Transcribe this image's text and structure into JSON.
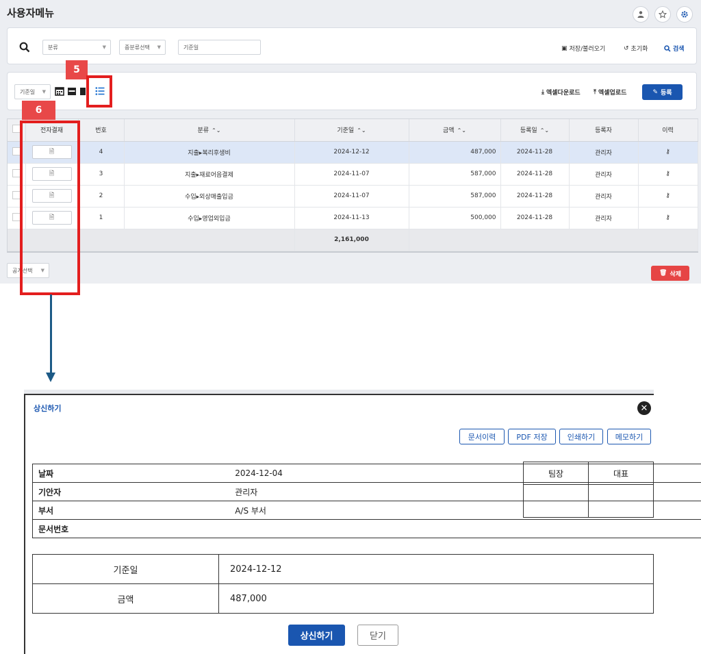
{
  "header": {
    "title": "사용자메뉴"
  },
  "search": {
    "category_placeholder": "분류",
    "subcategory_placeholder": "중분류선택",
    "date_placeholder": "기준일",
    "save_load": "저장/불러오기",
    "reset": "초기화",
    "search": "검색"
  },
  "toolbar": {
    "date_select": "기준일",
    "excel_download": "엑셀다운로드",
    "excel_upload": "엑셀업로드",
    "register": "등록"
  },
  "table": {
    "headers": [
      "전자결재",
      "번호",
      "분류",
      "기준일",
      "금액",
      "등록일",
      "등록자",
      "이력"
    ],
    "rows": [
      {
        "no": "4",
        "category": "지출▸복리후생비",
        "date": "2024-12-12",
        "amount": "487,000",
        "reg_date": "2024-11-28",
        "registrant": "관리자"
      },
      {
        "no": "3",
        "category": "지출▸재료어음결제",
        "date": "2024-11-07",
        "amount": "587,000",
        "reg_date": "2024-11-28",
        "registrant": "관리자"
      },
      {
        "no": "2",
        "category": "수입▸외상매출입금",
        "date": "2024-11-07",
        "amount": "587,000",
        "reg_date": "2024-11-28",
        "registrant": "관리자"
      },
      {
        "no": "1",
        "category": "수입▸영업외입금",
        "date": "2024-11-13",
        "amount": "500,000",
        "reg_date": "2024-11-28",
        "registrant": "관리자"
      }
    ],
    "total": "2,161,000"
  },
  "footer": {
    "bulk_select": "공개선택",
    "delete": "삭제"
  },
  "annotations": {
    "badge5": "5",
    "badge6": "6"
  },
  "modal": {
    "title": "상신하기",
    "buttons": [
      "문서이력",
      "PDF 저장",
      "인쇄하기",
      "메모하기"
    ],
    "info": [
      {
        "label": "날짜",
        "value": "2024-12-04"
      },
      {
        "label": "기안자",
        "value": "관리자"
      },
      {
        "label": "부서",
        "value": "A/S 부서"
      },
      {
        "label": "문서번호",
        "value": ""
      }
    ],
    "approvers": [
      "팀장",
      "대표"
    ],
    "detail": [
      {
        "label": "기준일",
        "value": "2024-12-12"
      },
      {
        "label": "금액",
        "value": "487,000"
      }
    ],
    "submit": "상신하기",
    "cancel": "닫기"
  },
  "colors": {
    "primary": "#1a56b0",
    "danger": "#e64545",
    "highlight": "#e31e1e",
    "arrow": "#1c5a86"
  }
}
